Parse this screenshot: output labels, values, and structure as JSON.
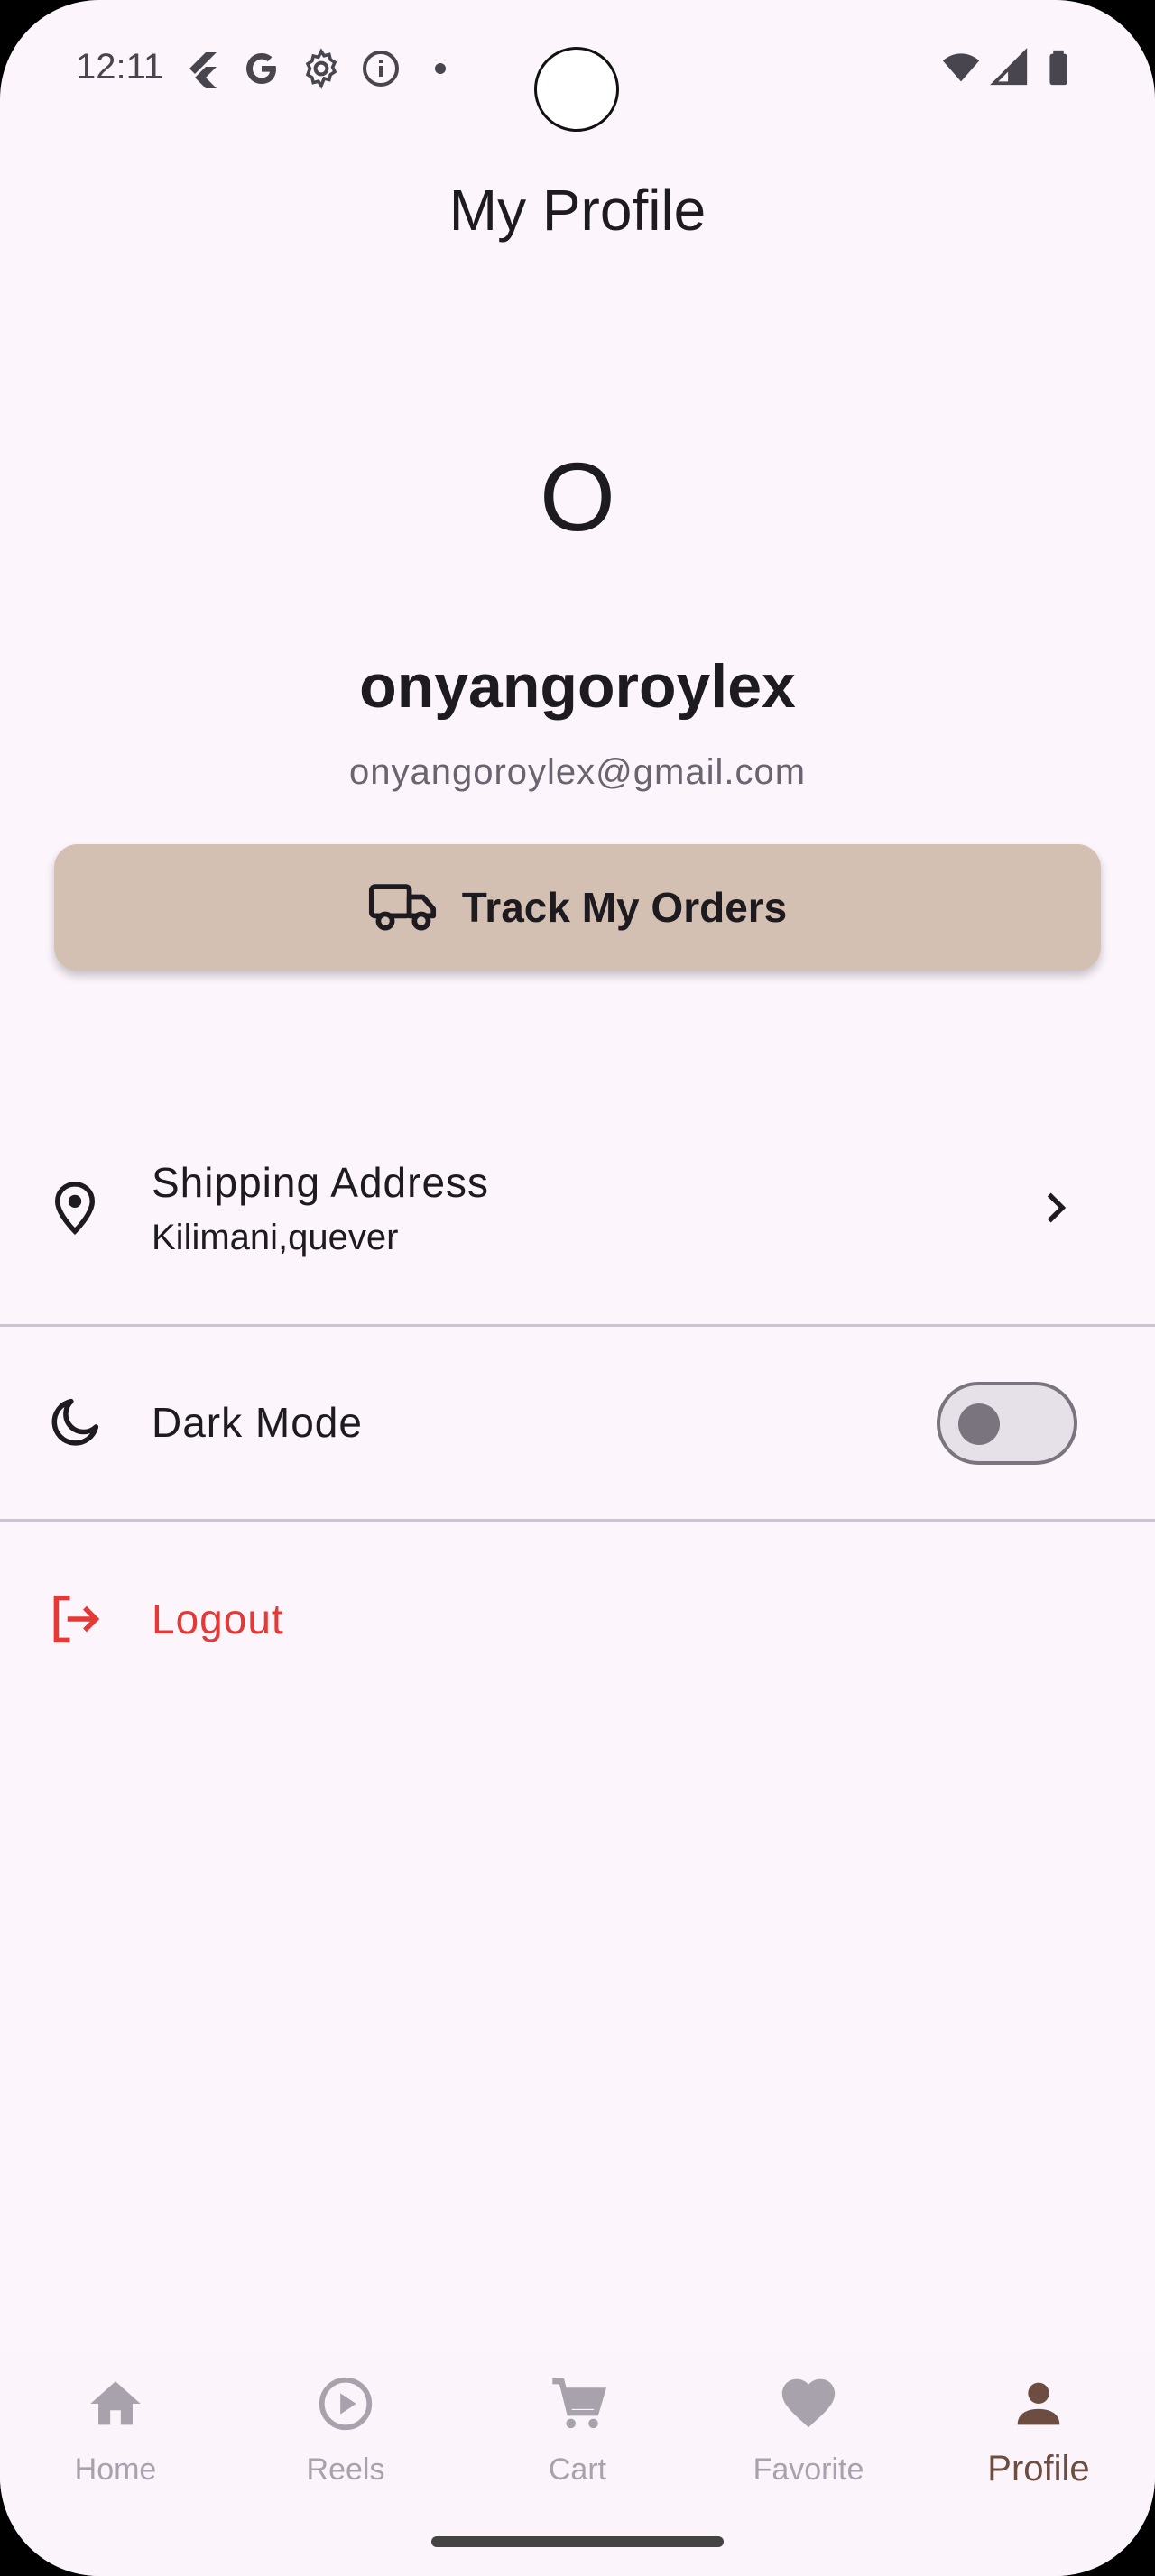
{
  "status_bar": {
    "time": "12:11",
    "left_icons": [
      "flutter-icon",
      "google-icon",
      "settings-icon",
      "info-icon",
      "dot-icon"
    ],
    "right_icons": [
      "wifi-icon",
      "signal-icon",
      "battery-icon"
    ]
  },
  "header": {
    "title": "My Profile"
  },
  "profile": {
    "avatar_initial": "O",
    "username": "onyangoroylex",
    "email": "onyangoroylex@gmail.com"
  },
  "track_orders": {
    "label": "Track My Orders",
    "icon": "truck-icon"
  },
  "shipping": {
    "title": "Shipping Address",
    "subtitle": "Kilimani,quever",
    "icon": "location-pin-icon"
  },
  "dark_mode": {
    "label": "Dark Mode",
    "enabled": false,
    "icon": "moon-icon"
  },
  "logout": {
    "label": "Logout",
    "color": "#e53935",
    "icon": "logout-icon"
  },
  "bottom_nav": {
    "items": [
      {
        "label": "Home",
        "icon": "home-icon",
        "active": false
      },
      {
        "label": "Reels",
        "icon": "play-circle-icon",
        "active": false
      },
      {
        "label": "Cart",
        "icon": "cart-icon",
        "active": false
      },
      {
        "label": "Favorite",
        "icon": "heart-icon",
        "active": false
      },
      {
        "label": "Profile",
        "icon": "person-icon",
        "active": true
      }
    ]
  },
  "colors": {
    "background": "#fcf6fc",
    "track_button": "#d4c0b2",
    "active_nav": "#6d4c41",
    "inactive_nav": "#a8a2ad"
  }
}
